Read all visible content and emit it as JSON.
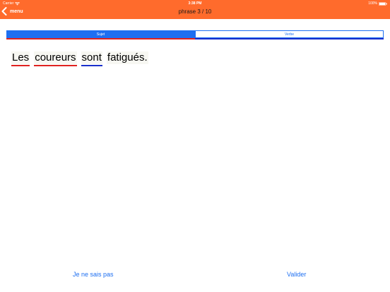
{
  "status_bar": {
    "carrier": "Carrier",
    "time": "3:38 PM",
    "battery": "100%"
  },
  "nav": {
    "back_label": "menu",
    "title": "phrase 3 / 10",
    "bar_color": "#FF6B2C"
  },
  "segments": [
    {
      "label": "Sujet",
      "selected": true,
      "color": "#E0221F"
    },
    {
      "label": "Verbe",
      "selected": false,
      "color": "#1A2FCC"
    }
  ],
  "sentence": {
    "words": [
      {
        "text": "Les",
        "tag": "Sujet",
        "underline_color": "#E0221F"
      },
      {
        "text": "coureurs",
        "tag": "Sujet",
        "underline_color": "#E0221F"
      },
      {
        "text": "sont",
        "tag": "Verbe",
        "underline_color": "#1A2FCC"
      },
      {
        "text": "fatigués.",
        "tag": null,
        "underline_color": null
      }
    ]
  },
  "actions": {
    "dont_know_label": "Je ne sais pas",
    "validate_label": "Valider"
  },
  "colors": {
    "accent": "#1E6FF1",
    "word_background": "#F7F7F2"
  }
}
